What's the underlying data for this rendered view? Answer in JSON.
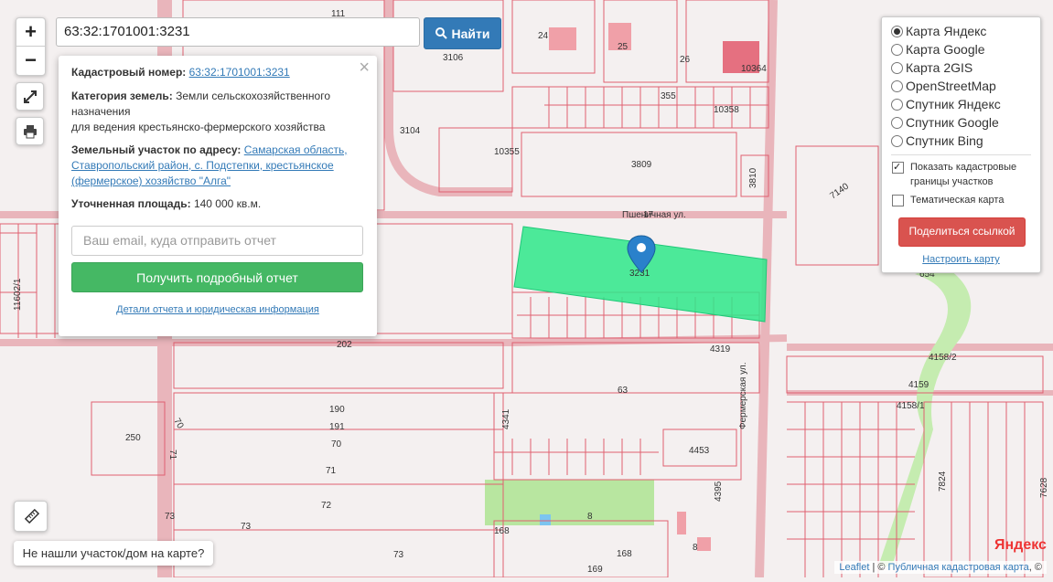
{
  "search": {
    "value": "63:32:1701001:3231",
    "button_label": "Найти"
  },
  "popup": {
    "cadastral_label": "Кадастровый номер:",
    "cadastral_value": "63:32:1701001:3231",
    "category_label": "Категория земель:",
    "category_value": "Земли сельскохозяйственного назначения",
    "usage_value": "для ведения крестьянско-фермерского хозяйства",
    "address_label": "Земельный участок по адресу:",
    "address_value": "Самарская область, Ставропольский район, с. Подстепки, крестьянское (фермерское) хозяйство \"Алга\"",
    "area_label": "Уточненная площадь:",
    "area_value": "140 000 кв.м.",
    "email_placeholder": "Ваш email, куда отправить отчет",
    "report_button": "Получить подробный отчет",
    "details_link": "Детали отчета и юридическая информация"
  },
  "layers": {
    "options": [
      "Карта Яндекс",
      "Карта Google",
      "Карта 2GIS",
      "OpenStreetMap",
      "Спутник Яндекс",
      "Спутник Google",
      "Спутник Bing"
    ],
    "selected_index": 0,
    "show_borders_label": "Показать кадастровые границы участков",
    "show_borders_checked": true,
    "thematic_label": "Тематическая карта",
    "thematic_checked": false,
    "share_button": "Поделиться ссылкой",
    "setup_link": "Настроить карту"
  },
  "controls": {
    "zoom_in": "+",
    "zoom_out": "−"
  },
  "not_found_button": "Не нашли участок/дом на карте?",
  "attribution": {
    "leaflet": "Leaflet",
    "separator": " | © ",
    "map_link": "Публичная кадастровая карта",
    "suffix": ", ©"
  },
  "map": {
    "yandex_logo": "Яндекс",
    "street_labels": [
      "Пшеничная ул.",
      "Фермерская ул."
    ],
    "parcel_labels": [
      "111",
      "24",
      "25",
      "26",
      "10364",
      "3106",
      "355",
      "10358",
      "3104",
      "10355",
      "3809",
      "3810",
      "7140",
      "17",
      "3231",
      "654",
      "11602/1",
      "202",
      "4319",
      "4158/2",
      "4159",
      "4158/1",
      "63",
      "190",
      "191",
      "70",
      "70",
      "250",
      "71",
      "71",
      "4341",
      "4453",
      "72",
      "73",
      "73",
      "4395",
      "168",
      "8",
      "7824",
      "168",
      "73",
      "8",
      "169",
      "7628"
    ],
    "colors": {
      "selected_parcel": "#2ee88a",
      "parcel_line": "#e06070",
      "marker": "#2a81cb",
      "green_zone": "#b8e6a0"
    }
  }
}
